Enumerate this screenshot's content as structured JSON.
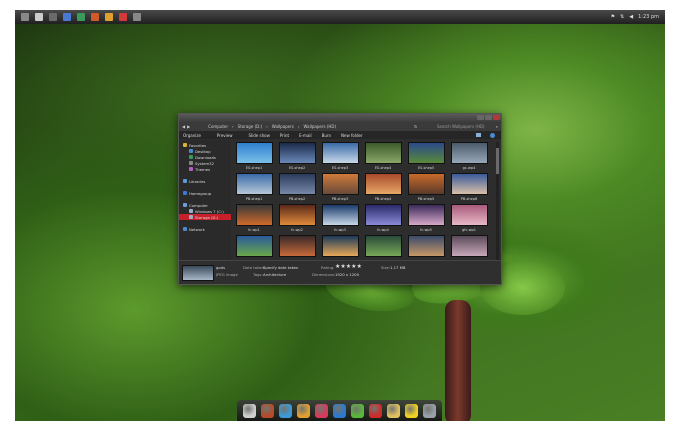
{
  "taskbar": {
    "clock": "1:23 pm"
  },
  "explorer": {
    "address_segments": [
      "Computer",
      "Storage (D:)",
      "Wallpapers",
      "Wallpapers (HD)"
    ],
    "search_placeholder": "Search Wallpapers (HD)",
    "toolbar": [
      "Organize",
      "Preview",
      "Slide show",
      "Print",
      "E-mail",
      "Burn",
      "New folder"
    ],
    "nav": [
      {
        "label": "Favorites",
        "color": "#e0b030"
      },
      {
        "label": "Desktop",
        "color": "#4a8ad0"
      },
      {
        "label": "Downloads",
        "color": "#3a9a5a"
      },
      {
        "label": "System32",
        "color": "#888888"
      },
      {
        "label": "Themes",
        "color": "#b060c0"
      },
      {
        "label": "Libraries",
        "color": "#5a9ad8"
      },
      {
        "label": "Homegroup",
        "color": "#3a7ad0"
      },
      {
        "label": "Computer",
        "color": "#6aa0d8"
      },
      {
        "label": "Windows 7 (C:)",
        "color": "#9ab0c8"
      },
      {
        "label": "Storage (D:)",
        "color": "#9ab0c8",
        "selected": true
      },
      {
        "label": "Network",
        "color": "#4a8ad0"
      }
    ],
    "files": [
      {
        "name": "ES-shep1",
        "c1": "#2f7fd0",
        "c2": "#7ac0e8"
      },
      {
        "name": "ES-shep2",
        "c1": "#1b2a4a",
        "c2": "#6a88b8"
      },
      {
        "name": "ES-shep3",
        "c1": "#3a6aa8",
        "c2": "#c8d8e8"
      },
      {
        "name": "ES-shep4",
        "c1": "#3a5a2a",
        "c2": "#8aa868"
      },
      {
        "name": "ES-shep5",
        "c1": "#2a4a8a",
        "c2": "#5a8a3a"
      },
      {
        "name": "gc-wp4",
        "c1": "#4a5a6a",
        "c2": "#98a8b8"
      },
      {
        "name": "PB-shep1",
        "c1": "#3a6aa8",
        "c2": "#b8c8d8"
      },
      {
        "name": "PB-shep2",
        "c1": "#2a3a5a",
        "c2": "#7888a8"
      },
      {
        "name": "PB-shep3",
        "c1": "#d07a3a",
        "c2": "#6a4a3a"
      },
      {
        "name": "PB-shep4",
        "c1": "#a84a2a",
        "c2": "#e8a868"
      },
      {
        "name": "PB-shep5",
        "c1": "#c86a2a",
        "c2": "#5a3a2a"
      },
      {
        "name": "PB-shep6",
        "c1": "#3a5a9a",
        "c2": "#d8c0a8"
      },
      {
        "name": "fc-wp1",
        "c1": "#3a3a3a",
        "c2": "#d06a2a"
      },
      {
        "name": "fc-wp2",
        "c1": "#5a2a1a",
        "c2": "#e08a3a"
      },
      {
        "name": "fc-wp3",
        "c1": "#1a3a6a",
        "c2": "#c8d8e8"
      },
      {
        "name": "fc-wp4",
        "c1": "#2a2a6a",
        "c2": "#8a8ad8"
      },
      {
        "name": "fc-wp5",
        "c1": "#3a2a5a",
        "c2": "#d8a8c8"
      },
      {
        "name": "gfc-wp1",
        "c1": "#a85a7a",
        "c2": "#e8b8c8"
      },
      {
        "name": "",
        "c1": "#2a5a9a",
        "c2": "#6aa84a"
      },
      {
        "name": "",
        "c1": "#3a2a2a",
        "c2": "#c86a3a"
      },
      {
        "name": "",
        "c1": "#1a3a5a",
        "c2": "#e8a858"
      },
      {
        "name": "",
        "c1": "#2a4a3a",
        "c2": "#78a858"
      },
      {
        "name": "",
        "c1": "#3a4a6a",
        "c2": "#c89868"
      },
      {
        "name": "",
        "c1": "#5a4a5a",
        "c2": "#c8a8b8"
      }
    ],
    "details": {
      "file_name": "gods",
      "file_type": "JPEG image",
      "date_label": "Date taken:",
      "date_value": "Specify date taken",
      "tags_label": "Tags:",
      "tags_value": "Architecture",
      "rating_label": "Rating:",
      "rating_value": "★★★★★",
      "dimensions_label": "Dimensions:",
      "dimensions_value": "1920 x 1200",
      "size_label": "Size:",
      "size_value": "1.17 MB"
    }
  },
  "dock": [
    {
      "name": "dock-app-1-icon",
      "color": "#cfcfcf"
    },
    {
      "name": "dock-app-2-icon",
      "color": "#b84a2a"
    },
    {
      "name": "dock-app-3-icon",
      "color": "#3a9ad8"
    },
    {
      "name": "dock-app-4-icon",
      "color": "#e0a030"
    },
    {
      "name": "dock-app-5-icon",
      "color": "#d83a5a"
    },
    {
      "name": "dock-app-6-icon",
      "color": "#2a7ad0"
    },
    {
      "name": "dock-app-7-icon",
      "color": "#58b83a"
    },
    {
      "name": "dock-app-8-icon",
      "color": "#d02a2a"
    },
    {
      "name": "dock-app-9-icon",
      "color": "#e0c060"
    },
    {
      "name": "dock-app-10-icon",
      "color": "#f0d020"
    },
    {
      "name": "dock-app-11-icon",
      "color": "#9aa0a8"
    }
  ]
}
